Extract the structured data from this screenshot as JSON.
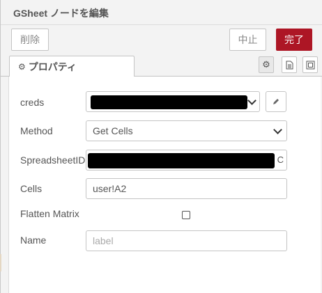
{
  "header": {
    "title": "GSheet ノードを編集",
    "delete_label": "削除",
    "cancel_label": "中止",
    "done_label": "完了"
  },
  "tabs": {
    "properties_label": "プロパティ",
    "icons": [
      "gear-icon",
      "document-icon",
      "frame-icon"
    ]
  },
  "form": {
    "creds_label": "creds",
    "method_label": "Method",
    "method_value": "Get Cells",
    "spreadsheet_label": "SpreadsheetID",
    "spreadsheet_suffix": "C",
    "cells_label": "Cells",
    "cells_value": "user!A2",
    "flatten_label": "Flatten Matrix",
    "flatten_checked": false,
    "name_label": "Name",
    "name_placeholder": "label"
  },
  "colors": {
    "accent": "#ad1625",
    "border": "#c4c4c4",
    "background": "#f3f3f3"
  }
}
